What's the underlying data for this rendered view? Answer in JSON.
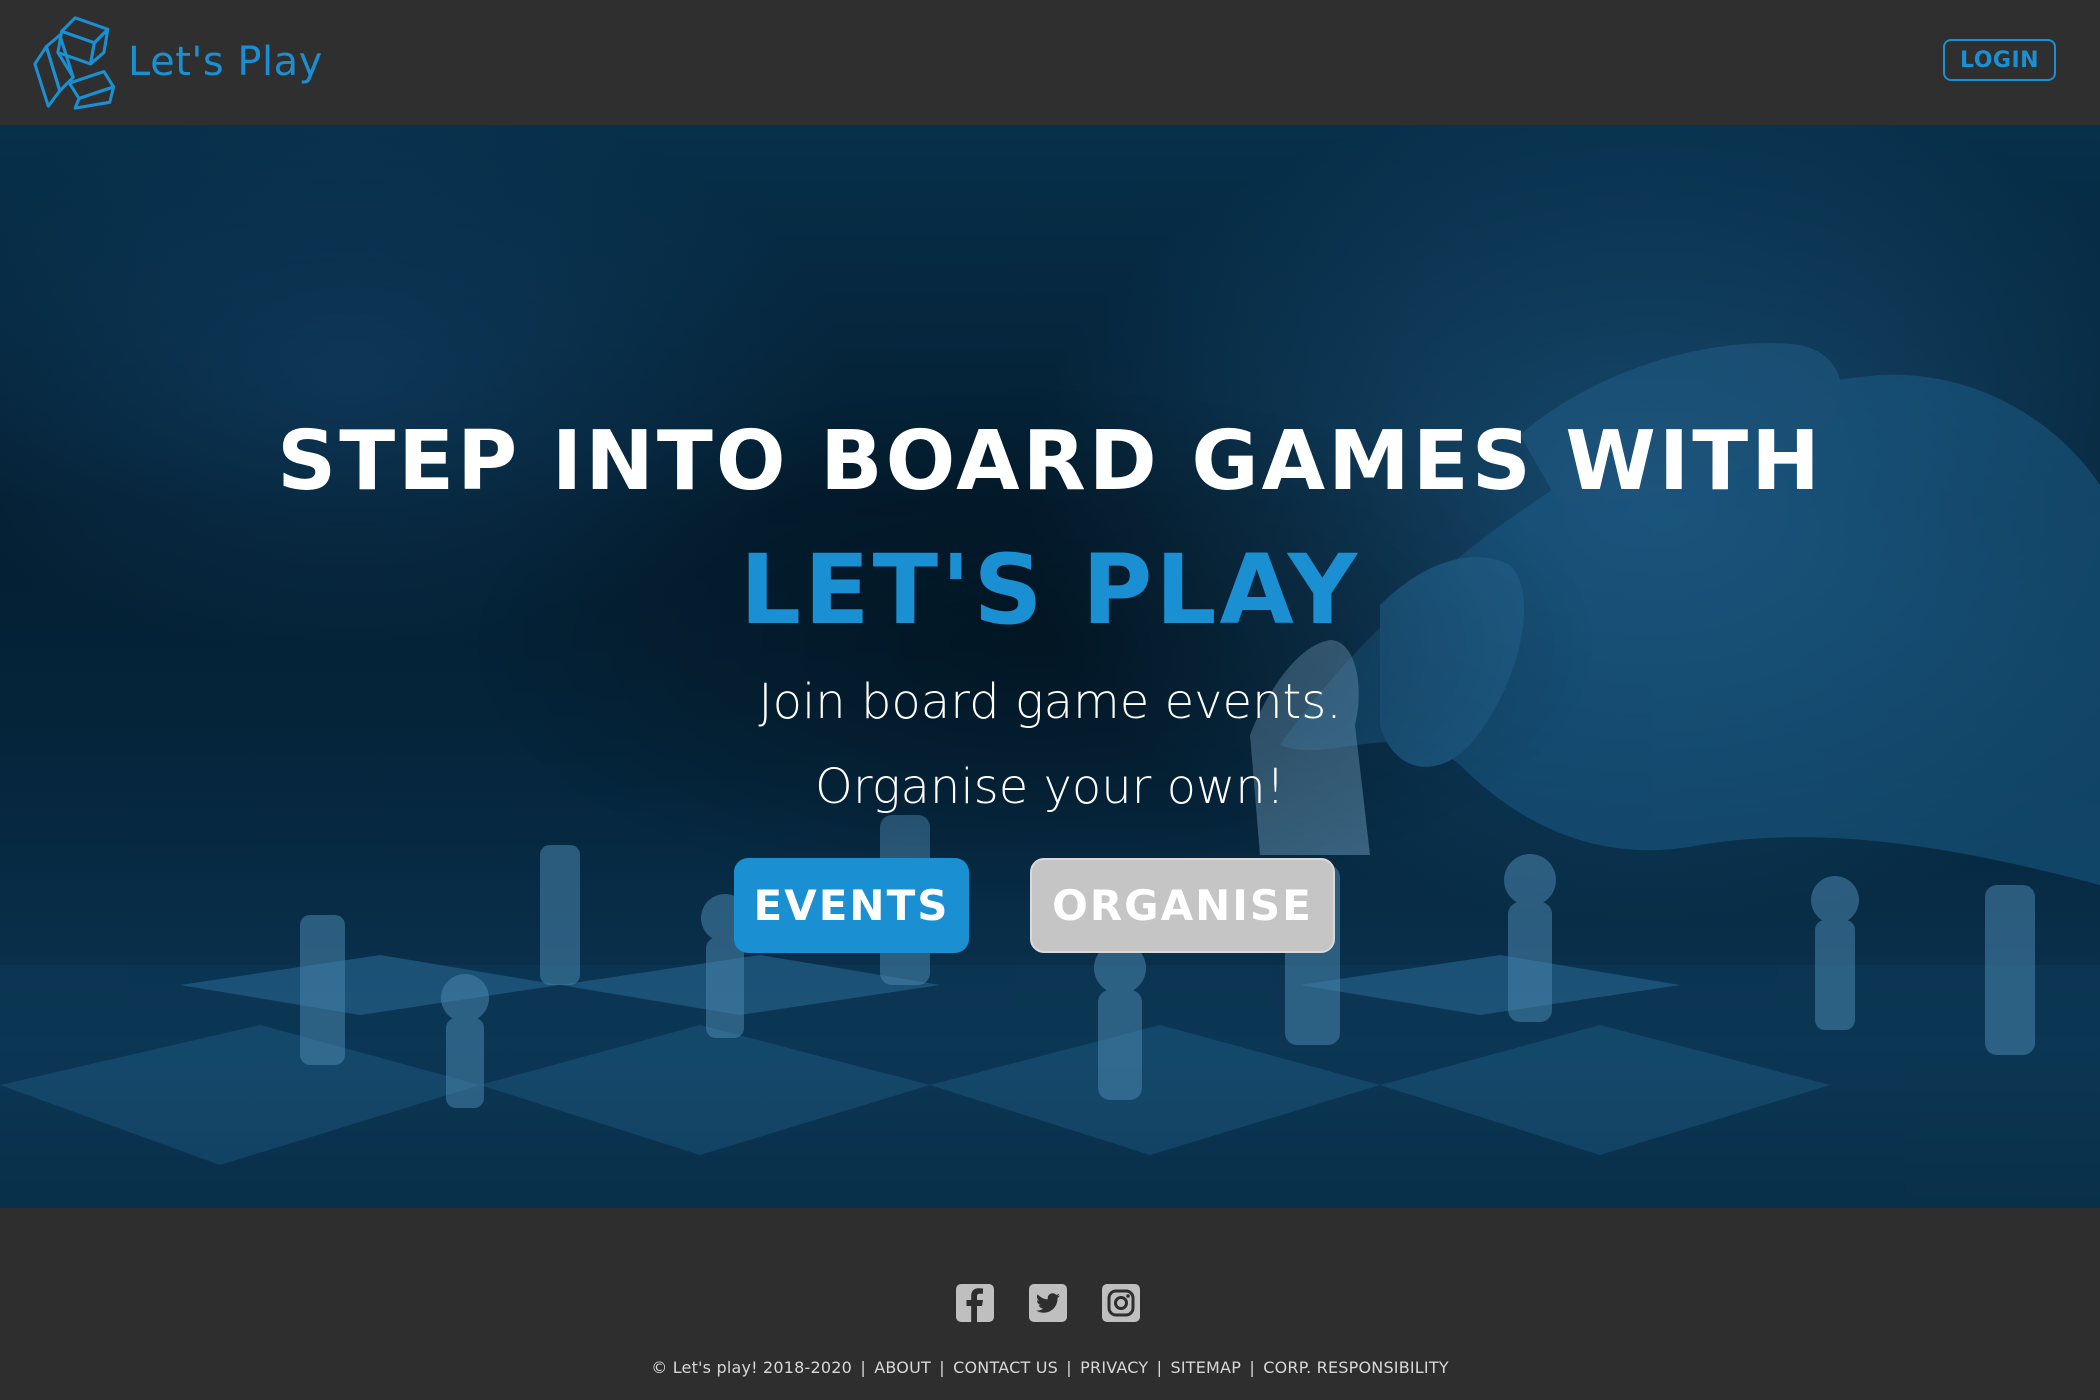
{
  "header": {
    "brand_name": "Let's Play",
    "login_label": "LOGIN"
  },
  "hero": {
    "title": "STEP INTO BOARD GAMES WITH",
    "brand": "LET'S PLAY",
    "subtitle_line1": "Join board game events.",
    "subtitle_line2": "Organise your own!",
    "events_label": "EVENTS",
    "organise_label": "ORGANISE"
  },
  "footer": {
    "social": [
      "facebook-icon",
      "twitter-icon",
      "instagram-icon"
    ],
    "copyright": "© Let's play! 2018-2020",
    "separator": "|",
    "links": {
      "about": "ABOUT",
      "contact": "CONTACT US",
      "privacy": "PRIVACY",
      "sitemap": "SITEMAP",
      "corp": "CORP. RESPONSIBILITY"
    }
  },
  "colors": {
    "accent": "#1a8fd1",
    "header_bg": "#2f2f2f",
    "footer_bg": "#2e2e2e",
    "organise_bg": "#c5c5c5",
    "hero_tint": "#06263d"
  }
}
